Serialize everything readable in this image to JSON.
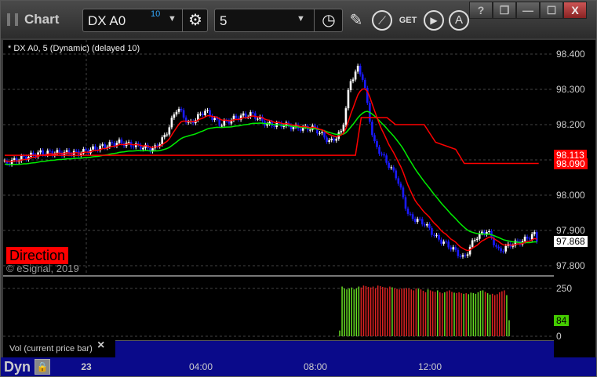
{
  "window": {
    "title": "Chart",
    "buttons": [
      "?",
      "❐",
      "—",
      "☐",
      "X"
    ]
  },
  "toolbar": {
    "symbol": "DX A0",
    "symbol_badge": "10",
    "interval": "5",
    "icons": [
      "gear-icon",
      "clock-icon",
      "pencil-icon",
      "study-icon",
      "get-icon",
      "play-icon",
      "alert-icon"
    ]
  },
  "chart": {
    "legend": "* DX A0, 5 (Dynamic) (delayed 10)",
    "direction_label": "Direction",
    "copyright": "© eSignal, 2019",
    "price_ticks": [
      "98.400",
      "98.300",
      "98.200",
      "98.100",
      "98.000",
      "97.900",
      "97.800"
    ],
    "price_tick_values": [
      98.4,
      98.3,
      98.2,
      98.1,
      98.0,
      97.9,
      97.8
    ],
    "markers": [
      {
        "text": "98.113",
        "value": 98.113,
        "color": "#ff0000"
      },
      {
        "text": "98.090",
        "value": 98.09,
        "color": "#ff0000"
      },
      {
        "text": "97.868",
        "value": 97.868,
        "color": "#ffffff"
      }
    ],
    "price_path": [
      [
        -2.85,
        98.09
      ],
      [
        -1.62,
        98.12
      ],
      [
        -0.25,
        98.12
      ],
      [
        1.12,
        98.15
      ],
      [
        2.36,
        98.13
      ],
      [
        2.77,
        98.17
      ],
      [
        3.18,
        98.25
      ],
      [
        3.59,
        98.2
      ],
      [
        4.14,
        98.24
      ],
      [
        4.68,
        98.2
      ],
      [
        5.23,
        98.22
      ],
      [
        5.78,
        98.23
      ],
      [
        6.33,
        98.2
      ],
      [
        6.88,
        98.2
      ],
      [
        7.42,
        98.19
      ],
      [
        7.97,
        98.19
      ],
      [
        8.52,
        98.15
      ],
      [
        8.93,
        98.18
      ],
      [
        9.21,
        98.32
      ],
      [
        9.48,
        98.36
      ],
      [
        9.67,
        98.33
      ],
      [
        10.03,
        98.15
      ],
      [
        10.44,
        98.1
      ],
      [
        10.85,
        98.05
      ],
      [
        11.26,
        97.94
      ],
      [
        11.81,
        97.92
      ],
      [
        12.22,
        97.88
      ],
      [
        12.77,
        97.85
      ],
      [
        13.18,
        97.82
      ],
      [
        13.59,
        97.88
      ],
      [
        14.0,
        97.9
      ],
      [
        14.41,
        97.84
      ],
      [
        14.82,
        97.86
      ],
      [
        15.23,
        97.87
      ],
      [
        15.64,
        97.89
      ],
      [
        15.78,
        97.868
      ]
    ],
    "red_step": [
      [
        -2.85,
        98.113
      ],
      [
        9.4,
        98.113
      ],
      [
        9.6,
        98.22
      ],
      [
        10.5,
        98.22
      ],
      [
        10.8,
        98.2
      ],
      [
        11.8,
        98.2
      ],
      [
        12.2,
        98.15
      ],
      [
        12.9,
        98.13
      ],
      [
        13.2,
        98.09
      ],
      [
        15.8,
        98.09
      ]
    ],
    "colors": {
      "up": "#ffffff",
      "down": "#1a1aff",
      "ma_fast": "#ff0000",
      "ma_slow": "#00ee00"
    }
  },
  "volume": {
    "label": "Vol (current price bar)",
    "ticks": [
      "250",
      "0"
    ],
    "tick_values": [
      250,
      0
    ],
    "current": "84",
    "current_value": 84,
    "start_hour": 8.85,
    "values": [
      30,
      260,
      250,
      245,
      250,
      255,
      245,
      250,
      260,
      255,
      265,
      262,
      258,
      255,
      260,
      250,
      265,
      262,
      258,
      255,
      252,
      260,
      256,
      250,
      248,
      245,
      250,
      248,
      252,
      250,
      245,
      240,
      250,
      248,
      245,
      238,
      230,
      245,
      240,
      235,
      232,
      240,
      230,
      225,
      230,
      235,
      240,
      232,
      228,
      226,
      230,
      225,
      222,
      225,
      220,
      228,
      226,
      222,
      230,
      238,
      240,
      232,
      225,
      218,
      222,
      215,
      220,
      230,
      235,
      240,
      215,
      84
    ],
    "up_color": "#66dd22",
    "down_color": "#dd2222"
  },
  "time_axis": {
    "labels": [
      "23",
      "04:00",
      "08:00",
      "12:00"
    ],
    "hours": [
      0,
      4,
      8,
      12
    ]
  },
  "bottom": {
    "mode": "Dyn"
  }
}
